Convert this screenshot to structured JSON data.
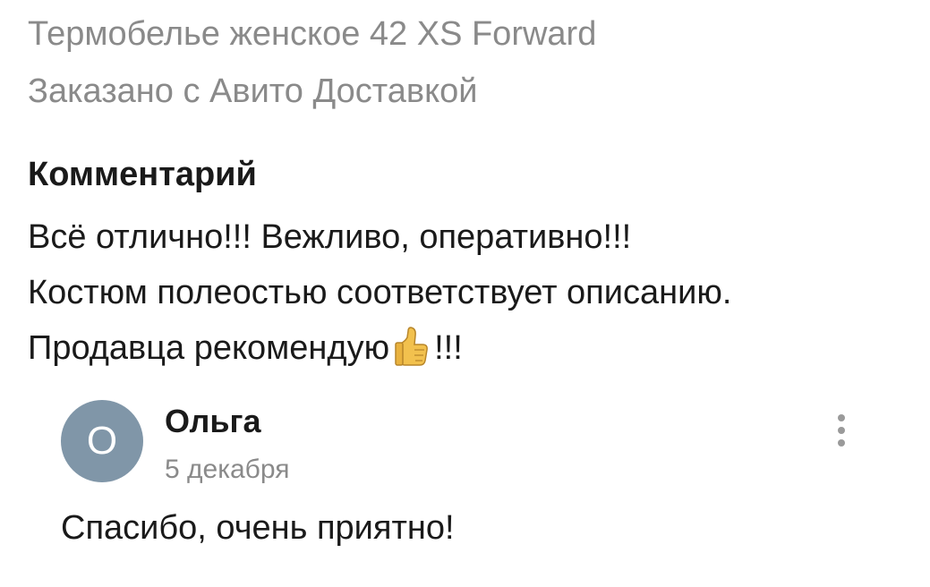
{
  "order": {
    "product_title": "Термобелье женское 42 XS Forward",
    "source": "Заказано с Авито Доставкой"
  },
  "comment": {
    "heading": "Комментарий",
    "line1": "Всё отлично!!! Вежливо, оперативно!!!",
    "line2": "Костюм полеостью соответствует описанию.",
    "line3_before": "Продавца рекомендую",
    "line3_icon": "thumbs-up-icon",
    "line3_after": "!!!"
  },
  "reply": {
    "avatar_letter": "О",
    "author": "Ольга",
    "date": "5 декабря",
    "text": "Спасибо, очень приятно!",
    "menu_icon": "more-vertical-icon",
    "avatar_color": "#8096a8"
  },
  "colors": {
    "muted_text": "#8a8a8a",
    "main_text": "#1a1a1a"
  }
}
